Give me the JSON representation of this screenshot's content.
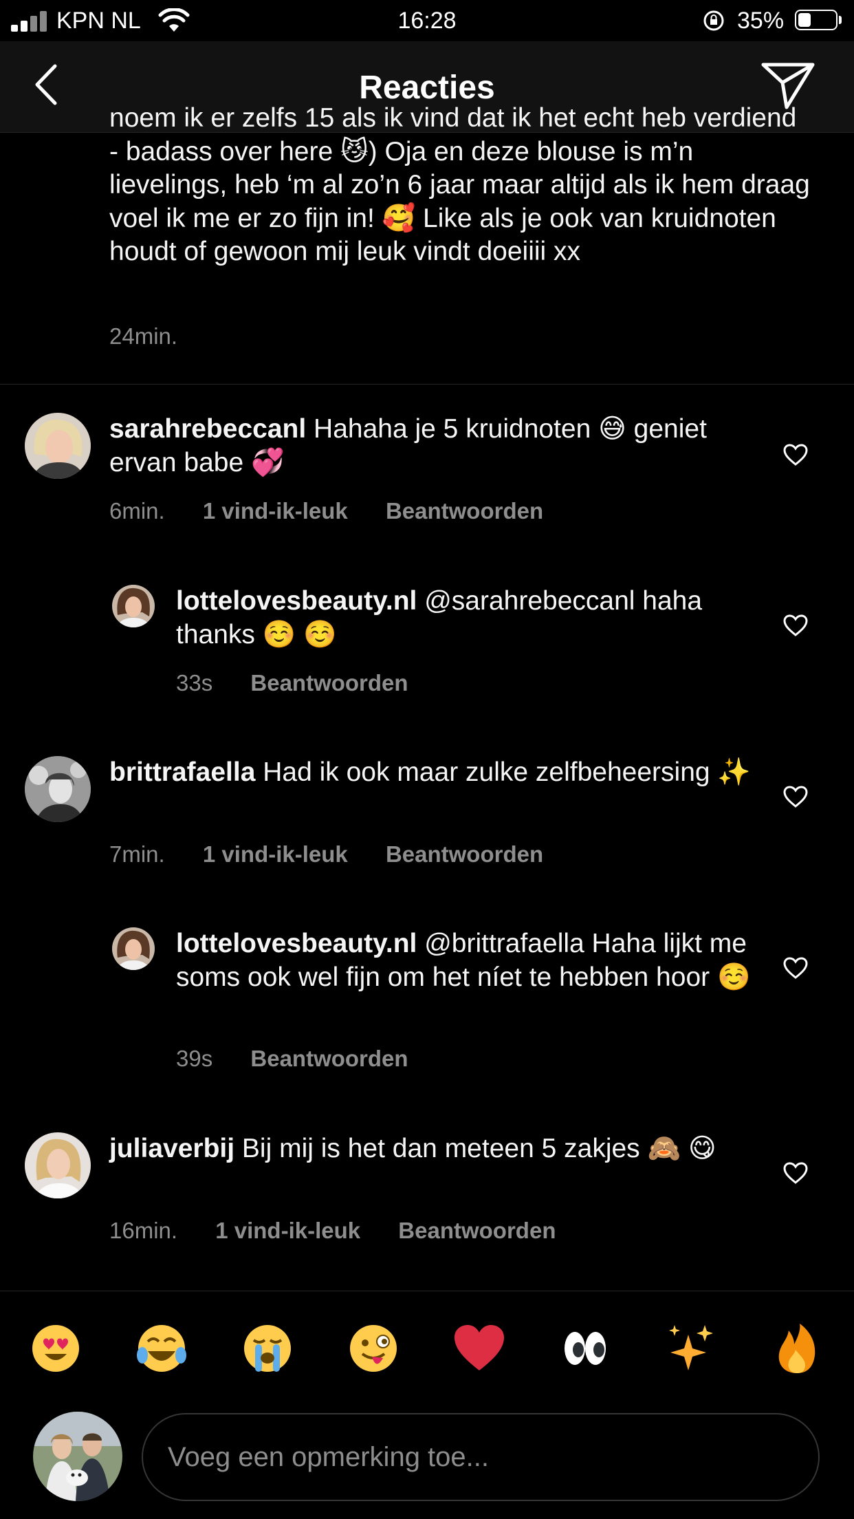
{
  "status_bar": {
    "carrier": "KPN NL",
    "time": "16:28",
    "battery": "35%",
    "battery_level": 0.35
  },
  "header": {
    "title": "Reacties"
  },
  "caption": {
    "text": "noem ik er zelfs 15 als ik vind dat ik het echt heb verdiend - badass over here 😼) Oja en deze blouse is m’n lievelings, heb ‘m al zo’n 6 jaar maar altijd als ik hem draag voel ik me er zo fijn in! 🥰 Like als je ook van kruidnoten houdt of gewoon mij leuk vindt doeiiii xx",
    "time": "24min."
  },
  "comments": [
    {
      "username": "sarahrebeccanl",
      "text": " Hahaha je 5 kruidnoten 😅 geniet ervan babe 💞",
      "time": "6min.",
      "likes": "1 vind-ik-leuk",
      "reply": "Beantwoorden"
    },
    {
      "username": "lottelovesbeauty.nl",
      "text": " @sarahrebeccanl haha thanks ☺️ ☺️",
      "time": "33s",
      "reply": "Beantwoorden"
    },
    {
      "username": "brittrafaella",
      "text": " Had ik ook maar zulke zelfbeheersing ✨",
      "time": "7min.",
      "likes": "1 vind-ik-leuk",
      "reply": "Beantwoorden"
    },
    {
      "username": "lottelovesbeauty.nl",
      "text": " @brittrafaella Haha lijkt me soms ook wel fijn om het níet te hebben hoor ☺️",
      "time": "39s",
      "reply": "Beantwoorden"
    },
    {
      "username": "juliaverbij",
      "text": " Bij mij is het dan meteen 5 zakjes 🙈 😋",
      "time": "16min.",
      "likes": "1 vind-ik-leuk",
      "reply": "Beantwoorden"
    }
  ],
  "emoji_bar": [
    "😍",
    "😂",
    "😭",
    "😜",
    "❤️",
    "👀",
    "✨",
    "🔥"
  ],
  "composer": {
    "placeholder": "Voeg een opmerking toe..."
  },
  "icons": {
    "back": "chevron-left-icon",
    "share": "paper-plane-icon",
    "like": "heart-outline-icon"
  },
  "colors": {
    "background": "#000000",
    "header": "#121212",
    "secondary_text": "#8e8e8e",
    "divider": "#262626"
  }
}
